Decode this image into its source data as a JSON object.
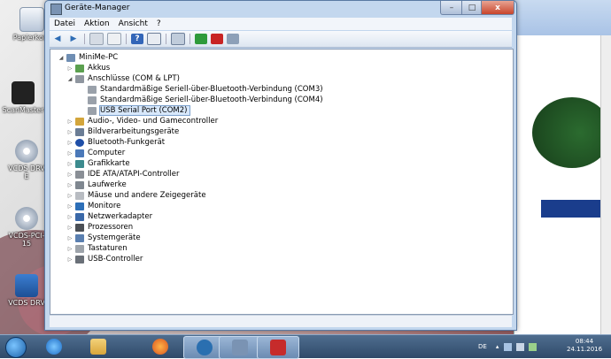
{
  "desktop": {
    "icons": [
      {
        "label": "Papierkorb",
        "icon": "recycle-bin-icon"
      },
      {
        "label": "ScanMaster",
        "icon": "app-icon"
      },
      {
        "label": "VCDS DRV E",
        "icon": "cd-icon"
      },
      {
        "label": "VCDS-PCI-15",
        "icon": "cd-icon"
      },
      {
        "label": "VCDS DRV",
        "icon": "vcds-icon"
      }
    ]
  },
  "window": {
    "title": "Geräte-Manager",
    "controls": {
      "minimize": "–",
      "maximize": "□",
      "close": "x"
    }
  },
  "menu": [
    "Datei",
    "Aktion",
    "Ansicht",
    "?"
  ],
  "toolbar": {
    "back": "◀",
    "forward": "▶",
    "help": "?",
    "refresh": "↻"
  },
  "tree": {
    "root": "MiniMe-PC",
    "nodes": [
      {
        "label": "Akkus",
        "level": 1,
        "expanded": false
      },
      {
        "label": "Anschlüsse (COM & LPT)",
        "level": 1,
        "expanded": true
      },
      {
        "label": "Standardmäßige Seriell-über-Bluetooth-Verbindung (COM3)",
        "level": 2
      },
      {
        "label": "Standardmäßige Seriell-über-Bluetooth-Verbindung (COM4)",
        "level": 2
      },
      {
        "label": "USB Serial Port (COM2)",
        "level": 2,
        "selected": true
      },
      {
        "label": "Audio-, Video- und Gamecontroller",
        "level": 1,
        "expanded": false
      },
      {
        "label": "Bildverarbeitungsgeräte",
        "level": 1,
        "expanded": false
      },
      {
        "label": "Bluetooth-Funkgerät",
        "level": 1,
        "expanded": false
      },
      {
        "label": "Computer",
        "level": 1,
        "expanded": false
      },
      {
        "label": "Grafikkarte",
        "level": 1,
        "expanded": false
      },
      {
        "label": "IDE ATA/ATAPI-Controller",
        "level": 1,
        "expanded": false
      },
      {
        "label": "Laufwerke",
        "level": 1,
        "expanded": false
      },
      {
        "label": "Mäuse und andere Zeigegeräte",
        "level": 1,
        "expanded": false
      },
      {
        "label": "Monitore",
        "level": 1,
        "expanded": false
      },
      {
        "label": "Netzwerkadapter",
        "level": 1,
        "expanded": false
      },
      {
        "label": "Prozessoren",
        "level": 1,
        "expanded": false
      },
      {
        "label": "Systemgeräte",
        "level": 1,
        "expanded": false
      },
      {
        "label": "Tastaturen",
        "level": 1,
        "expanded": false
      },
      {
        "label": "USB-Controller",
        "level": 1,
        "expanded": false
      }
    ]
  },
  "taskbar": {
    "language": "DE",
    "time": "08:44",
    "date": "24.11.2016"
  },
  "colors": {
    "selection": "#d8e8fb",
    "window_frame": "#c3d7ee"
  }
}
